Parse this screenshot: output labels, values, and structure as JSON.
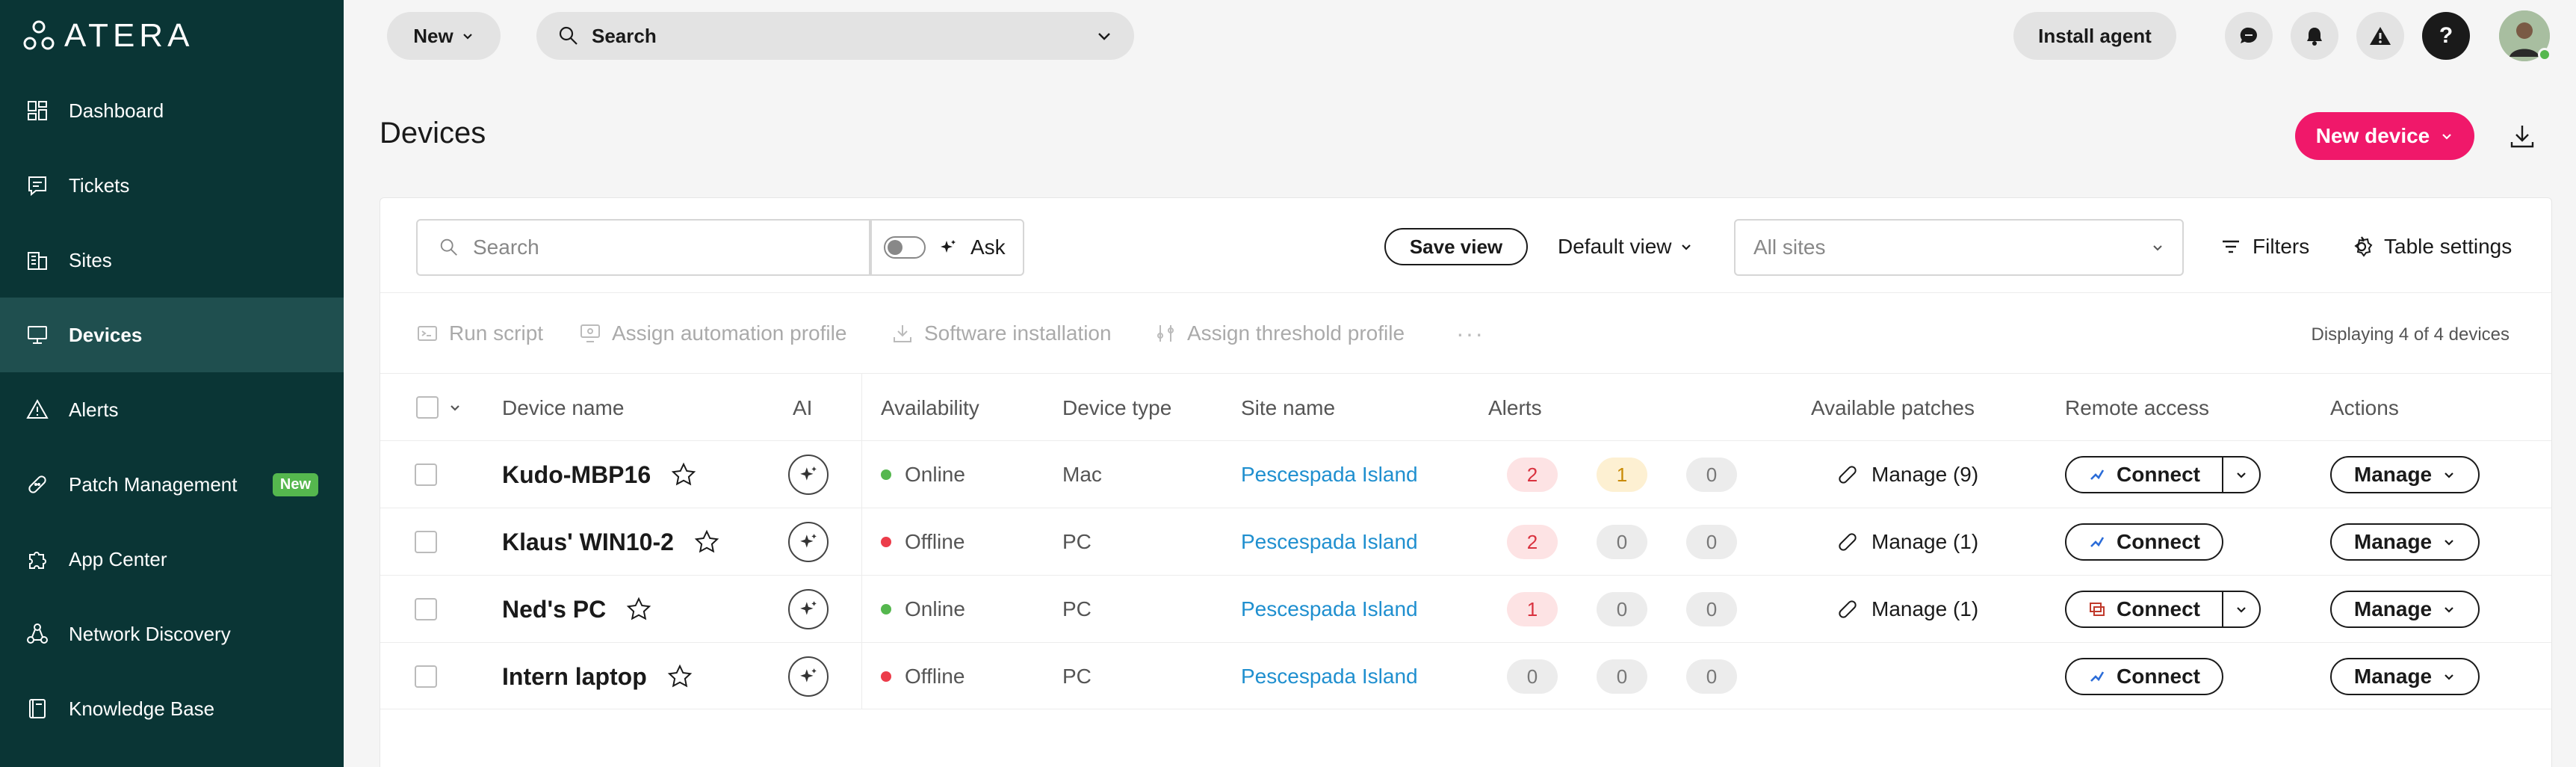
{
  "app": {
    "logo_text": "ATERA"
  },
  "sidebar": {
    "items": [
      {
        "label": "Dashboard",
        "icon": "dashboard-icon"
      },
      {
        "label": "Tickets",
        "icon": "ticket-icon"
      },
      {
        "label": "Sites",
        "icon": "building-icon"
      },
      {
        "label": "Devices",
        "icon": "monitor-icon",
        "active": true
      },
      {
        "label": "Alerts",
        "icon": "warning-icon"
      },
      {
        "label": "Patch Management",
        "icon": "bandage-icon",
        "badge": "New"
      },
      {
        "label": "App Center",
        "icon": "puzzle-icon"
      },
      {
        "label": "Network Discovery",
        "icon": "network-icon"
      },
      {
        "label": "Knowledge Base",
        "icon": "book-icon"
      }
    ]
  },
  "topbar": {
    "new_label": "New",
    "search_label": "Search",
    "install_agent_label": "Install agent",
    "help_label": "?"
  },
  "page": {
    "title": "Devices",
    "new_device_label": "New device"
  },
  "filters": {
    "search_placeholder": "Search",
    "ask_label": "Ask",
    "save_view_label": "Save view",
    "default_view_label": "Default view",
    "sites_placeholder": "All sites",
    "filters_label": "Filters",
    "table_settings_label": "Table settings"
  },
  "actions": {
    "run_script": "Run script",
    "assign_automation": "Assign automation profile",
    "software_installation": "Software installation",
    "assign_threshold": "Assign threshold profile",
    "more": "···",
    "display_count": "Displaying 4 of 4 devices"
  },
  "table": {
    "headers": {
      "device_name": "Device name",
      "ai": "AI",
      "availability": "Availability",
      "device_type": "Device type",
      "site_name": "Site name",
      "alerts": "Alerts",
      "patches": "Available patches",
      "remote": "Remote access",
      "actions": "Actions"
    },
    "rows": [
      {
        "name": "Kudo-MBP16",
        "availability": "Online",
        "type": "Mac",
        "site": "Pescespada Island",
        "alerts": [
          "2",
          "1",
          "0"
        ],
        "patches": "Manage (9)",
        "connect": "Connect",
        "manage": "Manage"
      },
      {
        "name": "Klaus' WIN10-2",
        "availability": "Offline",
        "type": "PC",
        "site": "Pescespada Island",
        "alerts": [
          "2",
          "0",
          "0"
        ],
        "patches": "Manage (1)",
        "connect": "Connect",
        "manage": "Manage"
      },
      {
        "name": "Ned's PC",
        "availability": "Online",
        "type": "PC",
        "site": "Pescespada Island",
        "alerts": [
          "1",
          "0",
          "0"
        ],
        "patches": "Manage (1)",
        "connect": "Connect",
        "manage": "Manage"
      },
      {
        "name": "Intern laptop",
        "availability": "Offline",
        "type": "PC",
        "site": "Pescespada Island",
        "alerts": [
          "0",
          "0",
          "0"
        ],
        "patches": "",
        "connect": "Connect",
        "manage": "Manage"
      }
    ]
  },
  "colors": {
    "sidebar": "#0a3535",
    "accent": "#f0186a",
    "link": "#1f8fcf",
    "online": "#55b74e",
    "offline": "#ec3c4a"
  }
}
